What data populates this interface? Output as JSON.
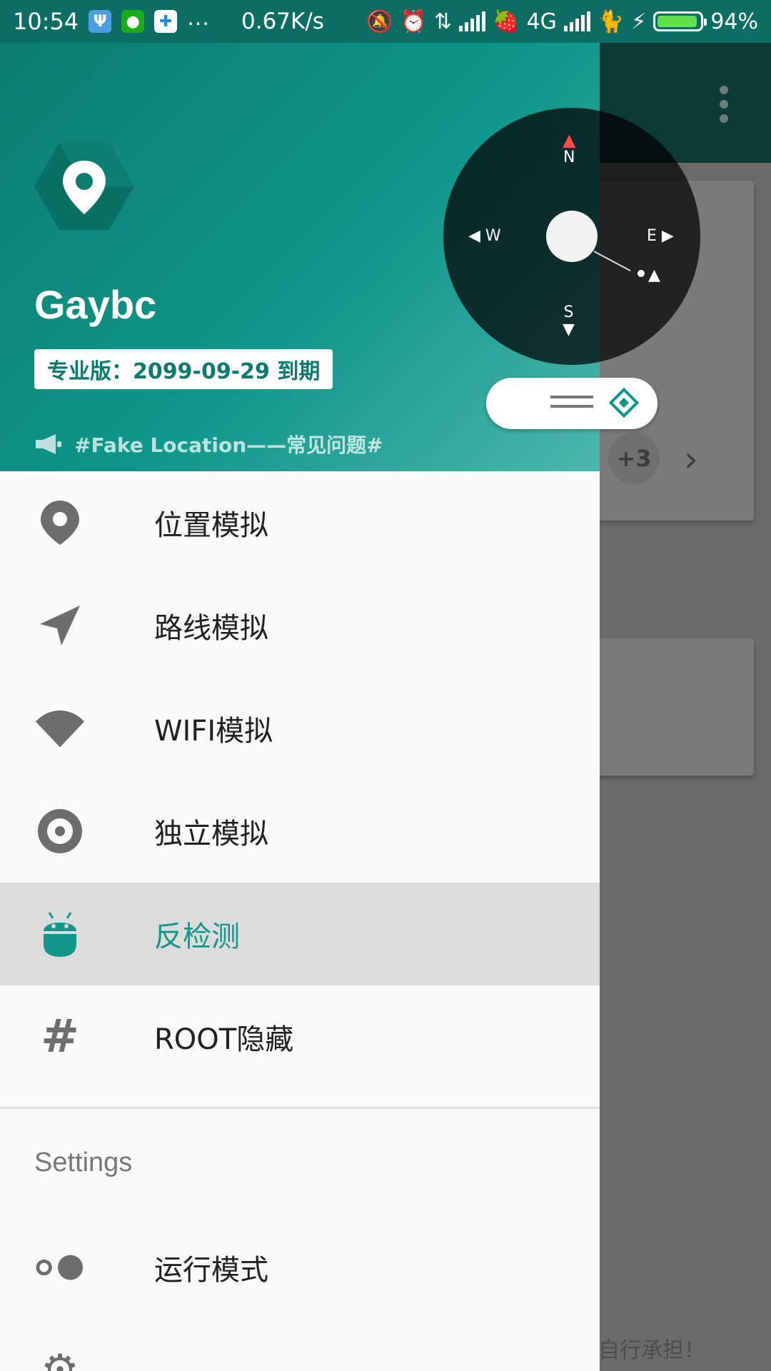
{
  "status_bar": {
    "time": "10:54",
    "overflow": "...",
    "net_speed": "0.67K/s",
    "network_type": "4G",
    "battery": "94%",
    "battery_level": 0.94
  },
  "header": {
    "user_name": "Gaybc",
    "pro_badge": "专业版：2099-09-29 到期",
    "notice": "#Fake Location——常见问题#"
  },
  "joystick": {
    "north": "N",
    "south": "S",
    "west": "W",
    "east": "E"
  },
  "menu": {
    "items": [
      {
        "label": "位置模拟",
        "icon": "location-pin-icon"
      },
      {
        "label": "路线模拟",
        "icon": "navigation-arrow-icon"
      },
      {
        "label": "WIFI模拟",
        "icon": "wifi-icon"
      },
      {
        "label": "独立模拟",
        "icon": "radio-target-icon"
      },
      {
        "label": "反检测",
        "icon": "android-icon"
      },
      {
        "label": "ROOT隐藏",
        "icon": "hash-icon"
      }
    ],
    "settings_title": "Settings",
    "settings_items": [
      {
        "label": "运行模式",
        "icon": "toggle-mode-icon"
      }
    ]
  },
  "background": {
    "badge": "+3",
    "footer_text": "自行承担！"
  },
  "colors": {
    "primary": "#0f968a",
    "primary_dark": "#0c6d62",
    "active_text": "#11968a"
  }
}
